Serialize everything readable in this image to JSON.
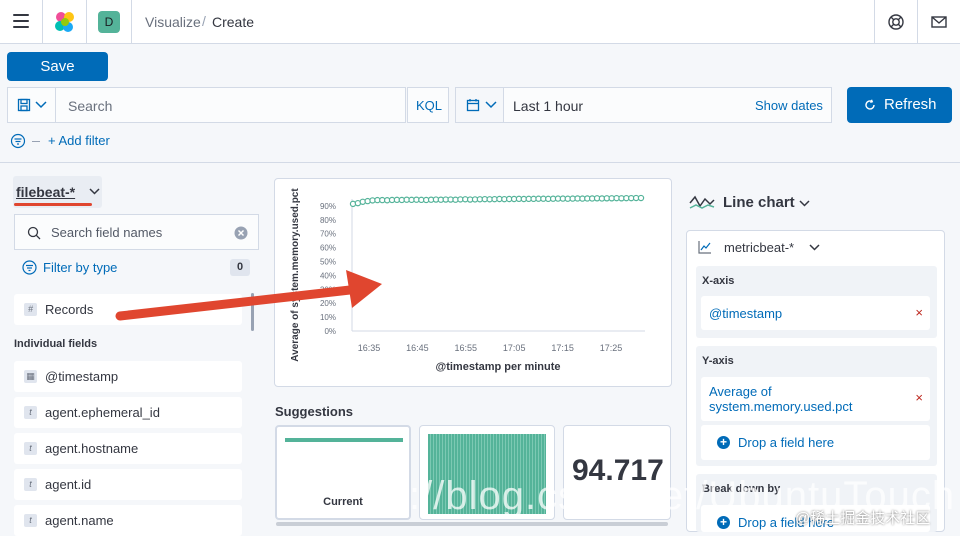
{
  "header": {
    "avatar_letter": "D",
    "breadcrumb_parent": "Visualize",
    "breadcrumb_separator": "/",
    "breadcrumb_current": "Create"
  },
  "toolbar": {
    "save_label": "Save"
  },
  "query": {
    "placeholder": "Search",
    "language_label": "KQL",
    "time_range": "Last 1 hour",
    "show_dates_label": "Show dates",
    "refresh_label": "Refresh",
    "add_filter_label": "+ Add filter"
  },
  "sidebar": {
    "index_pattern": "filebeat-*",
    "search_placeholder": "Search field names",
    "filter_by_type_label": "Filter by type",
    "filter_count": "0",
    "records_label": "Records",
    "individual_fields_heading": "Individual fields",
    "fields": [
      {
        "type_icon": "calendar",
        "name": "@timestamp"
      },
      {
        "type_icon": "t",
        "name": "agent.ephemeral_id"
      },
      {
        "type_icon": "t",
        "name": "agent.hostname"
      },
      {
        "type_icon": "t",
        "name": "agent.id"
      },
      {
        "type_icon": "t",
        "name": "agent.name"
      }
    ]
  },
  "chart_data": {
    "type": "line",
    "xlabel": "@timestamp per minute",
    "ylabel": "Average of system.memory.used.pct",
    "ylim": [
      0,
      95
    ],
    "ytick_labels": [
      "0%",
      "10%",
      "20%",
      "30%",
      "40%",
      "50%",
      "60%",
      "70%",
      "80%",
      "90%"
    ],
    "xtick_labels": [
      "16:35",
      "16:45",
      "16:55",
      "17:05",
      "17:15",
      "17:25"
    ],
    "x_minutes": [
      0,
      60
    ],
    "values": [
      91.5,
      92.0,
      93.0,
      93.5,
      94.0,
      94.2,
      94.2,
      94.1,
      94.3,
      94.4,
      94.3,
      94.5,
      94.4,
      94.5,
      94.4,
      94.3,
      94.5,
      94.6,
      94.5,
      94.6,
      94.6,
      94.5,
      94.7,
      94.8,
      94.6,
      94.7,
      94.8,
      94.9,
      94.8,
      94.9,
      95.0,
      94.9,
      95.0,
      95.0,
      95.1,
      95.0,
      95.1,
      95.1,
      95.2,
      95.2,
      95.1,
      95.2,
      95.3,
      95.3,
      95.2,
      95.3,
      95.4,
      95.3,
      95.4,
      95.4,
      95.5,
      95.4,
      95.5,
      95.5,
      95.6,
      95.5,
      95.6,
      95.6,
      95.7,
      95.7
    ],
    "color": "#54b399"
  },
  "suggestions": {
    "heading": "Suggestions",
    "current_label": "Current",
    "metric_value": "94.717"
  },
  "config": {
    "chart_type": "Line chart",
    "index_pattern": "metricbeat-*",
    "x_axis_label": "X-axis",
    "x_axis_value": "@timestamp",
    "y_axis_label": "Y-axis",
    "y_axis_value_line1": "Average of",
    "y_axis_value_line2": "system.memory.used.pct",
    "drop_label": "Drop a field here",
    "break_down_label": "Break down by"
  },
  "watermark": {
    "url_text": "s://blog.csdn.net/UbuntuTouch",
    "site_text": "@稀土掘金技术社区"
  },
  "colors": {
    "primary": "#006bb8",
    "accent_green": "#54b399",
    "annotation_red": "#e0462f"
  }
}
